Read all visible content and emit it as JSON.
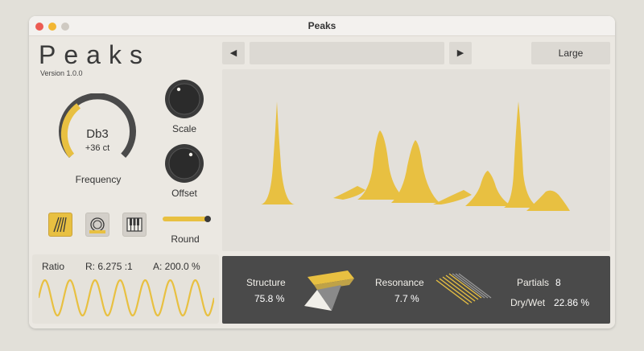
{
  "window": {
    "title": "Peaks"
  },
  "header": {
    "logo": "Peaks",
    "version": "Version 1.0.0"
  },
  "controls": {
    "frequency": {
      "note": "Db3",
      "cents": "+36 ct",
      "label": "Frequency"
    },
    "scale": {
      "label": "Scale"
    },
    "offset": {
      "label": "Offset"
    },
    "round": {
      "label": "Round"
    }
  },
  "ratio": {
    "label": "Ratio",
    "r_value": "R: 6.275 :1",
    "a_value": "A: 200.0 %"
  },
  "toolbar": {
    "prev_icon": "◀",
    "next_icon": "▶",
    "preset_value": "",
    "size_label": "Large"
  },
  "bottom": {
    "structure_label": "Structure",
    "structure_value": "75.8 %",
    "resonance_label": "Resonance",
    "resonance_value": "7.7 %",
    "partials_label": "Partials",
    "partials_value": "8",
    "drywet_label": "Dry/Wet",
    "drywet_value": "22.86 %"
  },
  "colors": {
    "accent": "#e8c041",
    "dark": "#3a3a3a",
    "panel_dark": "#4a4a4a",
    "background": "#ebe8e2"
  },
  "icons": {
    "mode1": "stripes-icon",
    "mode2": "rings-icon",
    "mode3": "piano-keys-icon"
  }
}
